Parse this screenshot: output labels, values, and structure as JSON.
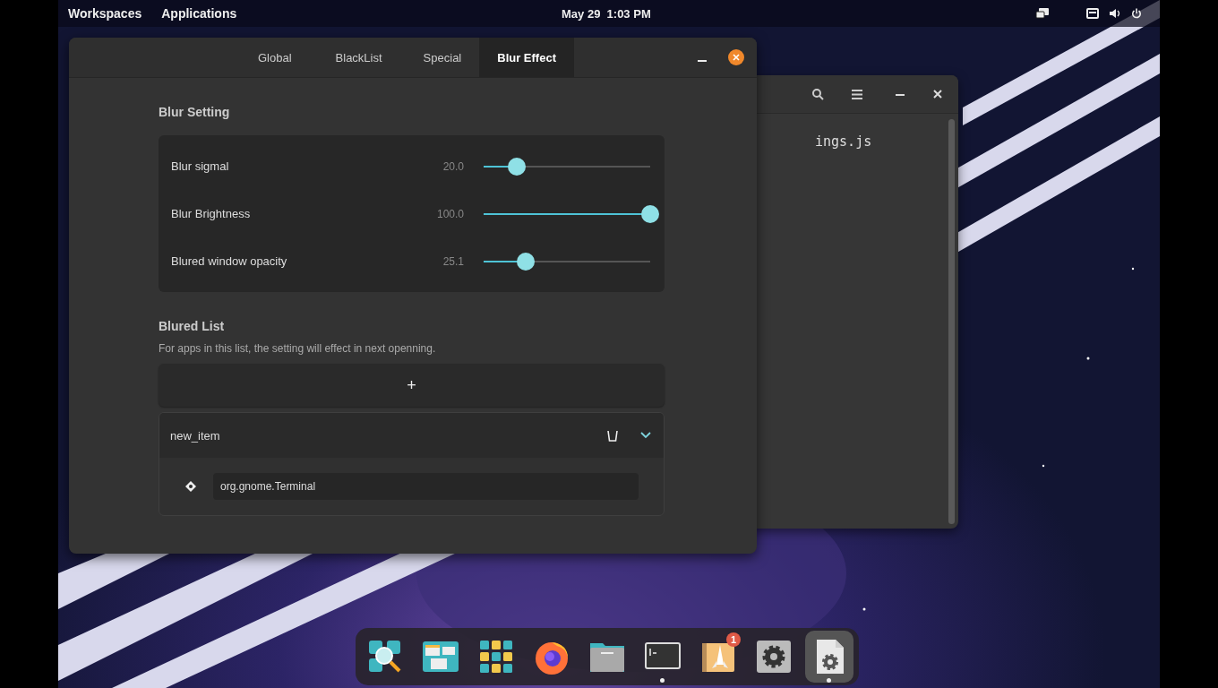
{
  "top_bar": {
    "menus": [
      "Workspaces",
      "Applications"
    ],
    "clock": "May 29  1:03 PM"
  },
  "settings_window": {
    "tabs": [
      {
        "label": "Global",
        "selected": false
      },
      {
        "label": "BlackList",
        "selected": false
      },
      {
        "label": "Special",
        "selected": false
      },
      {
        "label": "Blur Effect",
        "selected": true
      }
    ],
    "blur_setting": {
      "title": "Blur Setting",
      "sliders": [
        {
          "label": "Blur sigmal",
          "reading": "20.0",
          "level": 0.2
        },
        {
          "label": "Blur Brightness",
          "reading": "100.0",
          "level": 1.0
        },
        {
          "label": "Blured window opacity",
          "reading": "25.1",
          "level": 0.251
        }
      ]
    },
    "blured_list": {
      "title": "Blured List",
      "description": "For apps in this list, the setting will effect in next openning.",
      "add_button": "+",
      "items": [
        {
          "name": "new_item",
          "expanded": true,
          "entries": [
            {
              "value": "org.gnome.Terminal"
            }
          ]
        }
      ]
    }
  },
  "editor_window": {
    "text": "ings.js"
  },
  "dock": {
    "apps": [
      {
        "kind": "search",
        "running": false,
        "selected": false
      },
      {
        "kind": "windows",
        "running": false,
        "selected": false
      },
      {
        "kind": "grid",
        "running": false,
        "selected": false
      },
      {
        "kind": "browser",
        "running": false,
        "selected": false
      },
      {
        "kind": "folder",
        "running": false,
        "selected": false
      },
      {
        "kind": "terminal",
        "running": true,
        "selected": false
      },
      {
        "kind": "rocket",
        "running": false,
        "selected": false,
        "badge": "1"
      },
      {
        "kind": "gear",
        "running": false,
        "selected": false
      },
      {
        "kind": "gearfile",
        "running": true,
        "selected": true
      }
    ]
  }
}
